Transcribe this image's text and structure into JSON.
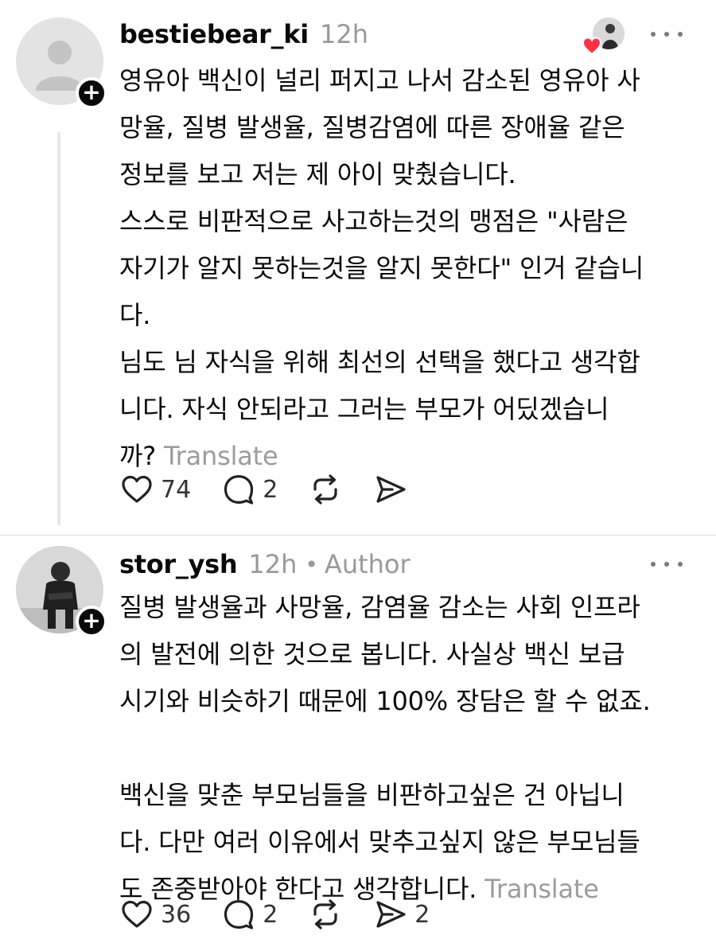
{
  "posts": [
    {
      "username": "bestiebear_ki",
      "time": "12h",
      "body": "영유아 백신이 널리 퍼지고 나서 감소된 영유아 사\n망율, 질병 발생율, 질병감염에 따른 장애율 같은\n정보를 보고 저는 제 아이 맞췄습니다.\n스스로 비판적으로 사고하는것의 맹점은 \"사람은\n자기가 알지 못하는것을 알지 못한다\" 인거 같습니\n다.\n님도 님 자식을 위해 최선의 선택을 했다고 생각합\n니다. 자식 안되라고 그러는 부모가 어딨겠습니\n까?",
      "translate": "Translate",
      "likes": "74",
      "replies": "2",
      "icons": [
        "heart-icon",
        "comment-icon",
        "repost-icon",
        "share-icon",
        "more-icon"
      ]
    },
    {
      "username": "stor_ysh",
      "time": "12h",
      "separator": "•",
      "author_badge": "Author",
      "body": "질병 발생율과 사망율, 감염율 감소는 사회 인프라\n의 발전에 의한 것으로 봅니다. 사실상 백신 보급\n시기와 비슷하기 때문에 100% 장담은 할 수 없죠.\n\n백신을 맞춘 부모님들을 비판하고싶은 건 아닙니\n다. 다만 여러 이유에서 맞추고싶지 않은 부모님들\n도 존중받아야 한다고 생각합니다.",
      "translate": "Translate",
      "likes": "36",
      "replies": "2",
      "shares": "2",
      "icons": [
        "heart-icon",
        "comment-icon",
        "repost-icon",
        "share-icon",
        "more-icon"
      ]
    }
  ],
  "colors": {
    "text": "#0a0a0a",
    "muted": "#999999",
    "like_heart": "#ff3040"
  }
}
